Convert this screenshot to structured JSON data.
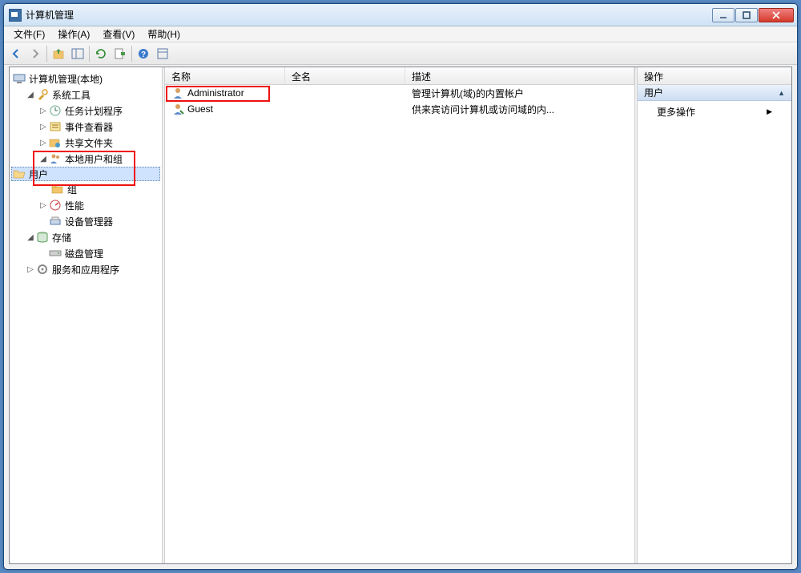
{
  "window": {
    "title": "计算机管理"
  },
  "menus": {
    "file": "文件(F)",
    "action": "操作(A)",
    "view": "查看(V)",
    "help": "帮助(H)"
  },
  "tree": {
    "root": "计算机管理(本地)",
    "system_tools": "系统工具",
    "task_scheduler": "任务计划程序",
    "event_viewer": "事件查看器",
    "shared_folders": "共享文件夹",
    "local_users_groups": "本地用户和组",
    "users": "用户",
    "groups": "组",
    "performance": "性能",
    "device_manager": "设备管理器",
    "storage": "存储",
    "disk_management": "磁盘管理",
    "services_apps": "服务和应用程序"
  },
  "list": {
    "headers": {
      "name": "名称",
      "fullname": "全名",
      "desc": "描述"
    },
    "rows": [
      {
        "name": "Administrator",
        "fullname": "",
        "desc": "管理计算机(域)的内置帐户"
      },
      {
        "name": "Guest",
        "fullname": "",
        "desc": "供来宾访问计算机或访问域的内..."
      }
    ]
  },
  "actions": {
    "header": "操作",
    "section": "用户",
    "more": "更多操作"
  }
}
